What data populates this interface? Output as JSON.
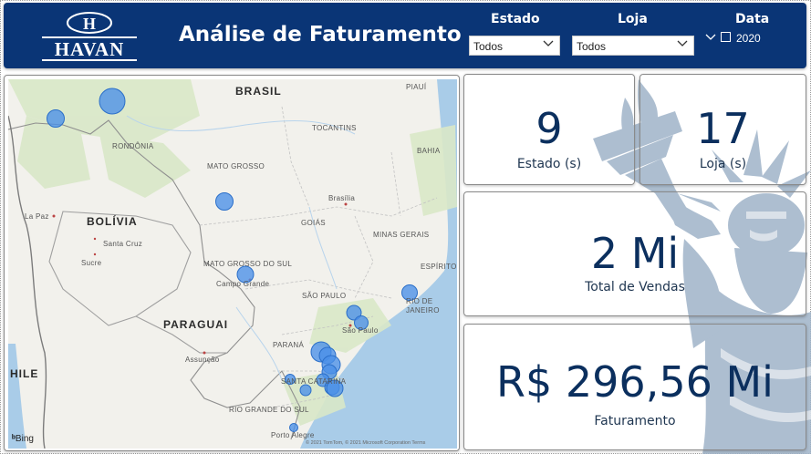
{
  "header": {
    "logo_text": "HAVAN",
    "logo_monogram": "H",
    "title": "Análise de Faturamento",
    "slicers": {
      "estado": {
        "label": "Estado",
        "value": "Todos"
      },
      "loja": {
        "label": "Loja",
        "value": "Todos"
      },
      "data": {
        "label": "Data",
        "option": "2020"
      }
    }
  },
  "map": {
    "labels": {
      "brasil": "BRASIL",
      "piaui": "PIAUÍ",
      "rondonia": "RONDÔNIA",
      "tocantins": "TOCANTINS",
      "bahia": "BAHIA",
      "mato_grosso": "MATO GROSSO",
      "brasilia": "Brasília",
      "goias": "GOIÁS",
      "bolivia": "BOLÍVIA",
      "la_paz": "La Paz",
      "santa_cruz": "Santa Cruz",
      "sucre": "Sucre",
      "minas_gerais": "MINAS GERAIS",
      "mato_grosso_do_sul": "MATO GROSSO DO SUL",
      "espirito": "ESPÍRITO",
      "campo_grande": "Campo Grande",
      "sao_paulo_state": "SÃO PAULO",
      "rio_de": "RIO DE",
      "janeiro": "JANEIRO",
      "paraguai": "PARAGUAI",
      "sao_paulo_city": "São Paulo",
      "parana": "PARANÁ",
      "chile": "HILE",
      "assuncao": "Assunção",
      "santa_catarina": "SANTA CATARINA",
      "rio_grande_do_sul": "RIO GRANDE DO SUL",
      "porto_alegre": "Porto Alegre"
    },
    "bing": "Bing",
    "copyright": "© 2021 TomTom, © 2021 Microsoft Corporation Terms",
    "bubble_color": "#4a90e8"
  },
  "kpis": {
    "estados": {
      "value": "9",
      "label": "Estado (s)"
    },
    "lojas": {
      "value": "17",
      "label": "Loja (s)"
    },
    "vendas": {
      "value": "2 Mi",
      "label": "Total de Vendas"
    },
    "faturamento": {
      "value": "R$ 296,56 Mi",
      "label": "Faturamento"
    }
  },
  "colors": {
    "header": "#0a3576",
    "kpi_text": "#0b2f5e",
    "statue": "#9fb3c8"
  }
}
